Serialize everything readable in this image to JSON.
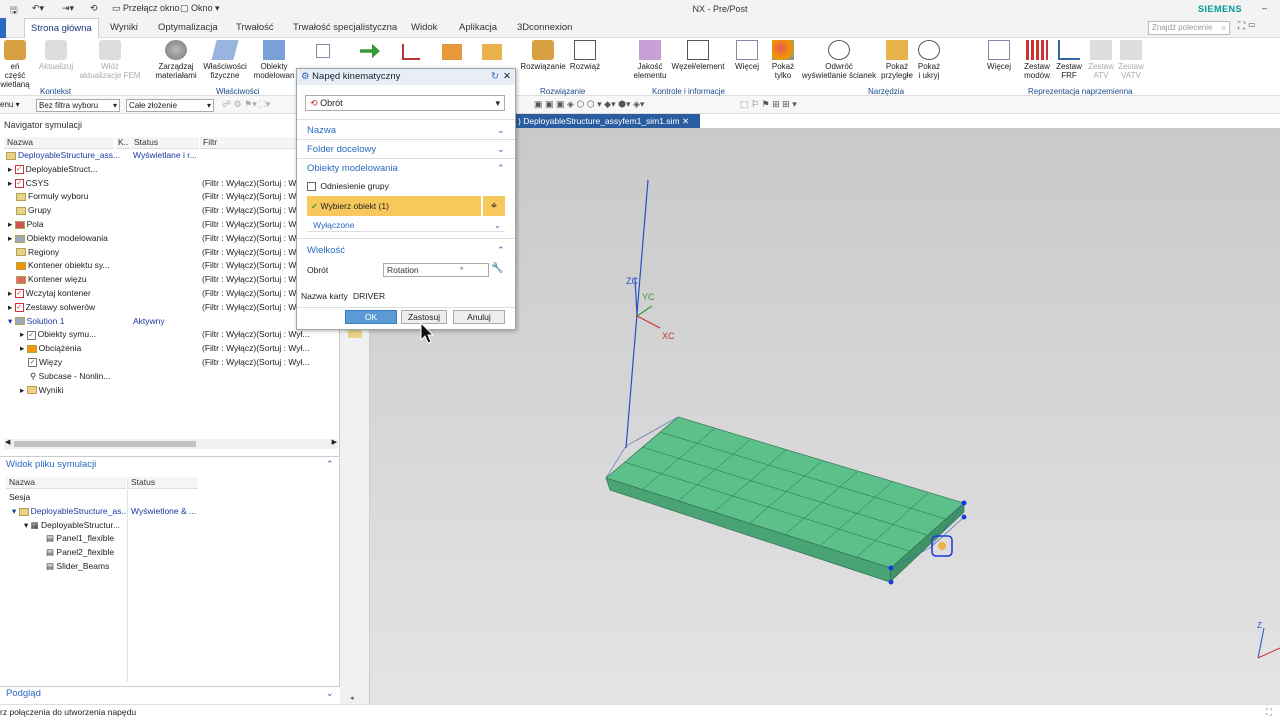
{
  "titlebar": {
    "title": "NX - Pre/Post",
    "brand": "SIEMENS",
    "switch_window": "Przełącz okno",
    "window_menu": "Okno"
  },
  "menubar": {
    "tabs": [
      "Strona główna",
      "Wyniki",
      "Optymalizacja",
      "Trwałość",
      "Trwałość specjalistyczna",
      "Widok",
      "Aplikacja",
      "3Dconnexion"
    ],
    "search_placeholder": "Znajdź polecenie"
  },
  "ribbon": {
    "buttons": [
      {
        "l1": "eń część",
        "l2": "wietlaną"
      },
      {
        "l1": "Aktualizuj",
        "l2": ""
      },
      {
        "l1": "Włóż",
        "l2": "aktualizacje FEM"
      },
      {
        "l1": "Zarządzaj",
        "l2": "materiałami"
      },
      {
        "l1": "Właściwości",
        "l2": "fizyczne"
      },
      {
        "l1": "Obiekty",
        "l2": "modelowan"
      },
      {
        "l1": "Rozwiązanie",
        "l2": ""
      },
      {
        "l1": "Rozwiąż",
        "l2": ""
      },
      {
        "l1": "Jakość",
        "l2": "elementu"
      },
      {
        "l1": "Węzeł/element",
        "l2": ""
      },
      {
        "l1": "Więcej",
        "l2": ""
      },
      {
        "l1": "Pokaż",
        "l2": "tylko"
      },
      {
        "l1": "Odwróć",
        "l2": "wyświetlanie ścianek"
      },
      {
        "l1": "Pokaż",
        "l2": "przyległe"
      },
      {
        "l1": "Pokaż",
        "l2": "i ukryj"
      },
      {
        "l1": "Więcej",
        "l2": ""
      },
      {
        "l1": "Zestaw",
        "l2": "modów"
      },
      {
        "l1": "Zestaw",
        "l2": "FRF"
      },
      {
        "l1": "Zestaw",
        "l2": "ATV"
      },
      {
        "l1": "Zestaw",
        "l2": "VATV"
      }
    ],
    "groups": [
      "Kontekst",
      "Właściwości",
      "Rozwiązanie",
      "Kontrole i informacje",
      "Narzędzia",
      "Reprezentacja naprzemienna"
    ]
  },
  "toolrow": {
    "menu": "enu",
    "filter": "Bez filtra wyboru",
    "assembly": "Całe złożenie"
  },
  "navigator": {
    "title": "Navigator symulacji",
    "columns": [
      "Nazwa",
      "K..",
      "Status",
      "Filtr"
    ],
    "rows": [
      {
        "name": "DeployableStructure_ass...",
        "status": "Wyświetlane i r...",
        "filter": ""
      },
      {
        "name": "DeployableStruct...",
        "status": "",
        "filter": ""
      },
      {
        "name": "CSYS",
        "status": "",
        "filter": "(Filtr : Wyłącz)(Sortuj : Wy"
      },
      {
        "name": "Formuły wyboru",
        "status": "",
        "filter": "(Filtr : Wyłącz)(Sortuj : Wy"
      },
      {
        "name": "Grupy",
        "status": "",
        "filter": "(Filtr : Wyłącz)(Sortuj : Wy"
      },
      {
        "name": "Pola",
        "status": "",
        "filter": "(Filtr : Wyłącz)(Sortuj : Wy"
      },
      {
        "name": "Obiekty modelowania",
        "status": "",
        "filter": "(Filtr : Wyłącz)(Sortuj : Wy"
      },
      {
        "name": "Regiony",
        "status": "",
        "filter": "(Filtr : Wyłącz)(Sortuj : Wy"
      },
      {
        "name": "Kontener obiektu sy...",
        "status": "",
        "filter": "(Filtr : Wyłącz)(Sortuj : Wy"
      },
      {
        "name": "Kontener więzu",
        "status": "",
        "filter": "(Filtr : Wyłącz)(Sortuj : Wy"
      },
      {
        "name": "Wczytaj kontener",
        "status": "",
        "filter": "(Filtr : Wyłącz)(Sortuj : Wy"
      },
      {
        "name": "Zestawy solwerów",
        "status": "",
        "filter": "(Filtr : Wyłącz)(Sortuj : Wy"
      },
      {
        "name": "Solution 1",
        "status": "Aktywny",
        "filter": ""
      },
      {
        "name": "Obiekty symu...",
        "status": "",
        "filter": "(Filtr : Wyłącz)(Sortuj : Wył..."
      },
      {
        "name": "Obciążenia",
        "status": "",
        "filter": "(Filtr : Wyłącz)(Sortuj : Wył..."
      },
      {
        "name": "Więzy",
        "status": "",
        "filter": "(Filtr : Wyłącz)(Sortuj : Wył..."
      },
      {
        "name": "Subcase - Nonlin...",
        "status": "",
        "filter": ""
      },
      {
        "name": "Wyniki",
        "status": "",
        "filter": ""
      }
    ]
  },
  "fileview": {
    "title": "Widok pliku symulacji",
    "columns": [
      "Nazwa",
      "Status"
    ],
    "rows": [
      {
        "name": "Sesja",
        "status": ""
      },
      {
        "name": "DeployableStructure_as...",
        "status": "Wyświetlone & ..."
      },
      {
        "name": "DeployableStructur...",
        "status": ""
      },
      {
        "name": "Panel1_flexible",
        "status": ""
      },
      {
        "name": "Panel2_flexible",
        "status": ""
      },
      {
        "name": "Slider_Beams",
        "status": ""
      }
    ]
  },
  "preview": {
    "title": "Podgląd"
  },
  "graphics": {
    "tab_label": ") DeployableStructure_assyfem1_sim1.sim",
    "axis_zc": "ZC",
    "axis_yc": "YC",
    "axis_xc": "XC",
    "mesh_color": "#5dbf8a"
  },
  "dialog": {
    "title": "Napęd kinematyczny",
    "type_value": "Obrót",
    "sections": {
      "name": "Nazwa",
      "folder": "Folder docelowy",
      "model_objects": "Obiekty modelowania",
      "size": "Wielkość"
    },
    "group_ref": "Odniesienie grupy",
    "select_object": "Wybierz obiekt (1)",
    "excluded": "Wyłączone",
    "rotation_label": "Obrót",
    "rotation_value": "Rotation",
    "rotation_unit": "°",
    "card_label": "Nazwa karty",
    "card_value": "DRIVER",
    "ok": "OK",
    "apply": "Zastosuj",
    "cancel": "Anuluj"
  },
  "status": {
    "text": "rz połączenia do utworzenia napędu"
  }
}
